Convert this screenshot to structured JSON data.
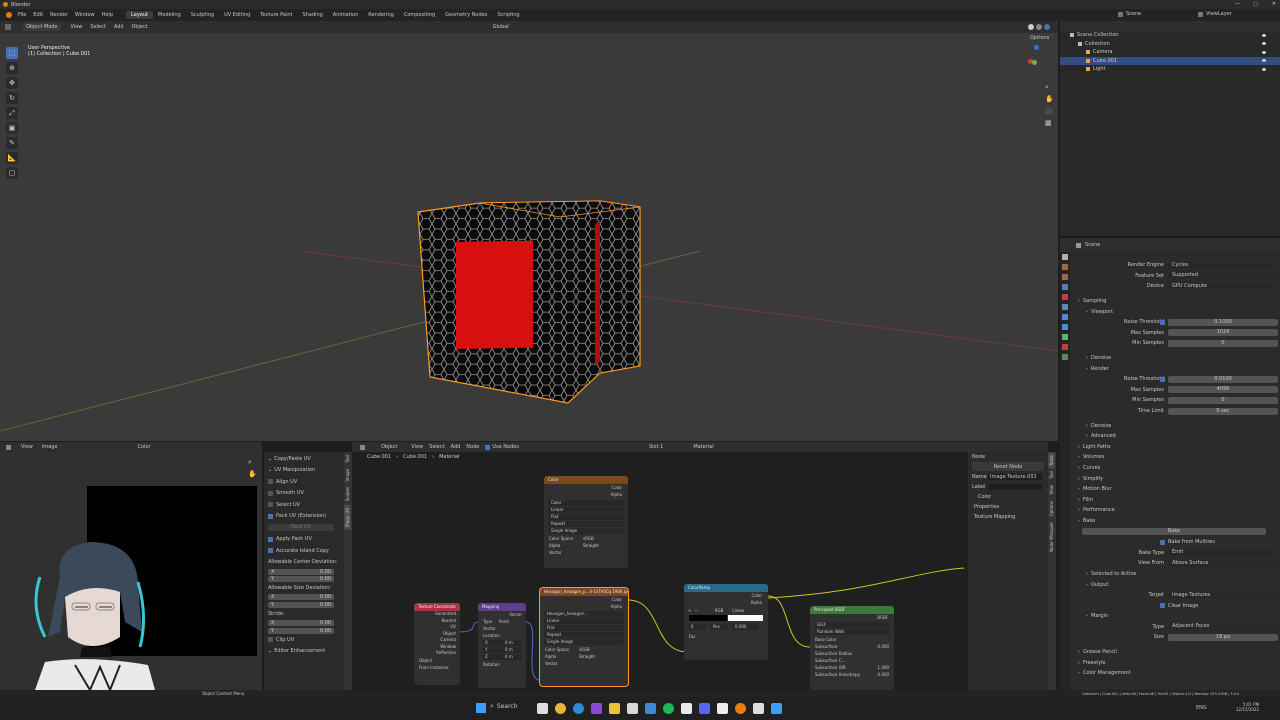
{
  "app": {
    "title": "Blender"
  },
  "menu": [
    "File",
    "Edit",
    "Render",
    "Window",
    "Help"
  ],
  "workspaces": [
    {
      "label": "Layout",
      "active": true
    },
    {
      "label": "Modeling"
    },
    {
      "label": "Sculpting"
    },
    {
      "label": "UV Editing"
    },
    {
      "label": "Texture Paint"
    },
    {
      "label": "Shading"
    },
    {
      "label": "Animation"
    },
    {
      "label": "Rendering"
    },
    {
      "label": "Compositing"
    },
    {
      "label": "Geometry Nodes"
    },
    {
      "label": "Scripting"
    }
  ],
  "top_right": {
    "scene": "Scene",
    "view_layer": "ViewLayer"
  },
  "viewport": {
    "mode": "Object Mode",
    "menus": [
      "View",
      "Select",
      "Add",
      "Object"
    ],
    "orientation": "Global",
    "options": "Options",
    "info_line1": "User Perspective",
    "info_line2": "(1) Collection | Cube.001"
  },
  "outliner": {
    "items": [
      {
        "label": "Scene Collection",
        "indent": 0
      },
      {
        "label": "Collection",
        "indent": 1
      },
      {
        "label": "Camera",
        "indent": 2
      },
      {
        "label": "Cube.001",
        "indent": 2,
        "selected": true
      },
      {
        "label": "Light",
        "indent": 2
      }
    ]
  },
  "properties": {
    "context": "Scene",
    "rows": [
      {
        "type": "field",
        "label": "Render Engine",
        "value": "Cycles",
        "dd": true
      },
      {
        "type": "field",
        "label": "Feature Set",
        "value": "Supported",
        "dd": true
      },
      {
        "type": "field",
        "label": "Device",
        "value": "GPU Compute",
        "dd": true
      },
      {
        "type": "gap"
      },
      {
        "type": "section",
        "label": "Sampling"
      },
      {
        "type": "sub",
        "label": "Viewport"
      },
      {
        "type": "field",
        "label": "Noise Threshold",
        "value": "0.1000",
        "check": true
      },
      {
        "type": "field",
        "label": "Max Samples",
        "value": "1024"
      },
      {
        "type": "field",
        "label": "Min Samples",
        "value": "0"
      },
      {
        "type": "gap"
      },
      {
        "type": "sub",
        "label": "Denoise"
      },
      {
        "type": "sub",
        "label": "Render"
      },
      {
        "type": "field",
        "label": "Noise Threshold",
        "value": "0.0100",
        "check": true
      },
      {
        "type": "field",
        "label": "Max Samples",
        "value": "4096"
      },
      {
        "type": "field",
        "label": "Min Samples",
        "value": "0"
      },
      {
        "type": "field",
        "label": "Time Limit",
        "value": "0 sec"
      },
      {
        "type": "gap"
      },
      {
        "type": "sub",
        "label": "Denoise"
      },
      {
        "type": "sub",
        "label": "Advanced"
      },
      {
        "type": "section",
        "label": "Light Paths"
      },
      {
        "type": "section",
        "label": "Volumes"
      },
      {
        "type": "section",
        "label": "Curves"
      },
      {
        "type": "section",
        "label": "Simplify"
      },
      {
        "type": "section",
        "label": "Motion Blur"
      },
      {
        "type": "section",
        "label": "Film"
      },
      {
        "type": "section",
        "label": "Performance"
      },
      {
        "type": "section",
        "label": "Bake"
      },
      {
        "type": "button",
        "value": "Bake"
      },
      {
        "type": "checkrow",
        "label": "Bake from Multires"
      },
      {
        "type": "field",
        "label": "Bake Type",
        "value": "Emit",
        "dd": true
      },
      {
        "type": "field",
        "label": "View From",
        "value": "Above Surface",
        "dd": true
      },
      {
        "type": "sub",
        "label": "Selected to Active"
      },
      {
        "type": "sub",
        "label": "Output"
      },
      {
        "type": "field",
        "label": "Target",
        "value": "Image Textures",
        "dd": true
      },
      {
        "type": "checkrow",
        "label": "Clear Image"
      },
      {
        "type": "sub",
        "label": "Margin"
      },
      {
        "type": "field",
        "label": "Type",
        "value": "Adjacent Faces",
        "dd": true
      },
      {
        "type": "field",
        "label": "Size",
        "value": "16 px"
      },
      {
        "type": "gap"
      },
      {
        "type": "section",
        "label": "Grease Pencil"
      },
      {
        "type": "section",
        "label": "Freestyle"
      },
      {
        "type": "section",
        "label": "Color Management"
      }
    ]
  },
  "image_editor": {
    "menus": [
      "View",
      "Image"
    ],
    "channel": "Color"
  },
  "uv_panel": {
    "items": [
      {
        "label": "Copy/Paste UV",
        "kind": "head"
      },
      {
        "label": "UV Manipulation",
        "kind": "head"
      },
      {
        "label": "Align UV",
        "kind": "check"
      },
      {
        "label": "Smooth UV",
        "kind": "check"
      },
      {
        "label": "Select UV",
        "kind": "check"
      },
      {
        "label": "Pack UV (Extension)",
        "kind": "checked"
      },
      {
        "label": "Pack UV",
        "kind": "btn"
      },
      {
        "label": "Apply Pack UV",
        "kind": "checked"
      },
      {
        "label": "Accurate Island Copy",
        "kind": "checked"
      },
      {
        "label": "Allowable Center Deviation:",
        "kind": "text"
      },
      {
        "label": "X",
        "kind": "num",
        "value": "0.00"
      },
      {
        "label": "Y",
        "kind": "num",
        "value": "0.00"
      },
      {
        "label": "Allowable Size Deviation:",
        "kind": "text"
      },
      {
        "label": "X",
        "kind": "num",
        "value": "0.00"
      },
      {
        "label": "Y",
        "kind": "num",
        "value": "0.00"
      },
      {
        "label": "Stride:",
        "kind": "text"
      },
      {
        "label": "X",
        "kind": "num",
        "value": "0.00"
      },
      {
        "label": "Y",
        "kind": "num",
        "value": "0.00"
      },
      {
        "label": "Clip UV",
        "kind": "check"
      },
      {
        "label": "Editor Enhancement",
        "kind": "head"
      }
    ],
    "tabs": [
      "Tool",
      "Image",
      "Scopes",
      "Magic UV"
    ]
  },
  "node_editor": {
    "type": "Object",
    "menus": [
      "View",
      "Select",
      "Add",
      "Node"
    ],
    "use_nodes": "Use Nodes",
    "slot": "Slot 1",
    "material": "Material",
    "breadcrumb": [
      "Cube.001",
      "Cube.001",
      "Material"
    ]
  },
  "nodes": {
    "color": {
      "title": "Color",
      "outs": [
        "Color",
        "Alpha"
      ],
      "fields": [
        "Color",
        "Linear",
        "Flat",
        "Repeat",
        "Single Image"
      ],
      "rows": [
        {
          "l": "Color Space",
          "v": "sRGB"
        },
        {
          "l": "Alpha",
          "v": "Straight"
        }
      ],
      "vector": "Vector"
    },
    "texcoord": {
      "title": "Texture Coordinate",
      "outs": [
        "Generated",
        "Normal",
        "UV",
        "Object",
        "Camera",
        "Window",
        "Reflection"
      ],
      "object": "Object",
      "from_instancer": "From Instancer"
    },
    "mapping": {
      "title": "Mapping",
      "out": "Vector",
      "type_l": "Type",
      "type_v": "Point",
      "vector": "Vector",
      "location": "Location",
      "rows": [
        {
          "l": "X",
          "v": "0 m"
        },
        {
          "l": "Y",
          "v": "0 m"
        },
        {
          "l": "Z",
          "v": "0 m"
        }
      ],
      "rotation": "Rotation"
    },
    "hex": {
      "title": "Hexagon_hexagon_p...4-1ii7h0Cq 1906.jpg",
      "outs": [
        "Color",
        "Alpha"
      ],
      "file": "Hexagon_hexagon...",
      "fields": [
        "Linear",
        "Flat",
        "Repeat",
        "Single Image"
      ],
      "rows": [
        {
          "l": "Color Space",
          "v": "sRGB"
        },
        {
          "l": "Alpha",
          "v": "Straight"
        }
      ],
      "vector": "Vector"
    },
    "ramp": {
      "title": "ColorRamp",
      "outs": [
        "Color",
        "Alpha"
      ],
      "mode": "RGB",
      "interp": "Linear",
      "pos": "0",
      "posv": "Pos",
      "posn": "0.000",
      "fac": "Fac"
    },
    "bsdf": {
      "title": "Principled BSDF",
      "out": "BSDF",
      "dist": "GGX",
      "sss": "Random Walk",
      "rows": [
        "Base Color",
        "Subsurface",
        "Subsurface Radius",
        "Subsurface C...",
        "Subsurface IOR",
        "Subsurface Anisotropy"
      ],
      "vals": {
        "Subsurface": "0.000",
        "Subsurface IOR": "1.400",
        "Subsurface Anisotropy": "0.000"
      }
    }
  },
  "npanel": {
    "section": "Node",
    "reset": "Reset Node",
    "name_l": "Name",
    "name_v": "Image Texture.001",
    "label_l": "Label",
    "sub": [
      "Color",
      "Properties",
      "Texture Mapping"
    ],
    "tabs": [
      "Node",
      "Tool",
      "View",
      "Options",
      "Node Wrangler"
    ]
  },
  "status": {
    "left": "Object Context Menu",
    "right": "Collection | Cube.001 | Verts:48 | Faces:46 | Tris:92 | Objects:1/3 | Memory: 523.4 MiB | 3.4.0"
  },
  "taskbar": {
    "search": "Search",
    "lang": "ENG",
    "time": "5:01 PM",
    "date": "12/15/2022"
  },
  "colors": {
    "accent": "#4772b3",
    "selection": "#ff9a1e",
    "node_color": "#7a4a1c",
    "node_texcoord": "#a4344a",
    "node_mapping": "#5a3f8a",
    "node_ramp": "#2a6a8a",
    "node_bsdf": "#3a7a3a"
  }
}
